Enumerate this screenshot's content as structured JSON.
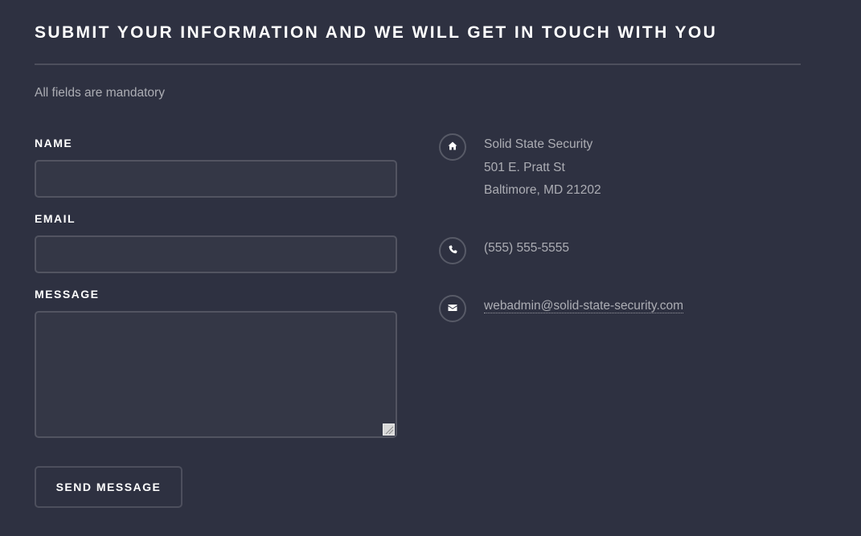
{
  "form": {
    "heading": "Submit your information and we will get in touch with you",
    "note": "All fields are mandatory",
    "name_label": "Name",
    "name_value": "",
    "email_label": "Email",
    "email_value": "",
    "message_label": "Message",
    "message_value": "",
    "submit_label": "Send Message"
  },
  "contact": {
    "address": {
      "icon": "home-icon",
      "line1": "Solid State Security",
      "line2": "501 E. Pratt St",
      "line3": "Baltimore, MD 21202"
    },
    "phone": {
      "icon": "phone-icon",
      "value": "(555) 555-5555"
    },
    "email": {
      "icon": "envelope-icon",
      "value": "webadmin@solid-state-security.com"
    }
  },
  "colors": {
    "background": "#2e3141",
    "text": "#ffffff",
    "muted_text": "rgba(255,255,255,0.6)",
    "border": "rgba(255,255,255,0.15)"
  }
}
